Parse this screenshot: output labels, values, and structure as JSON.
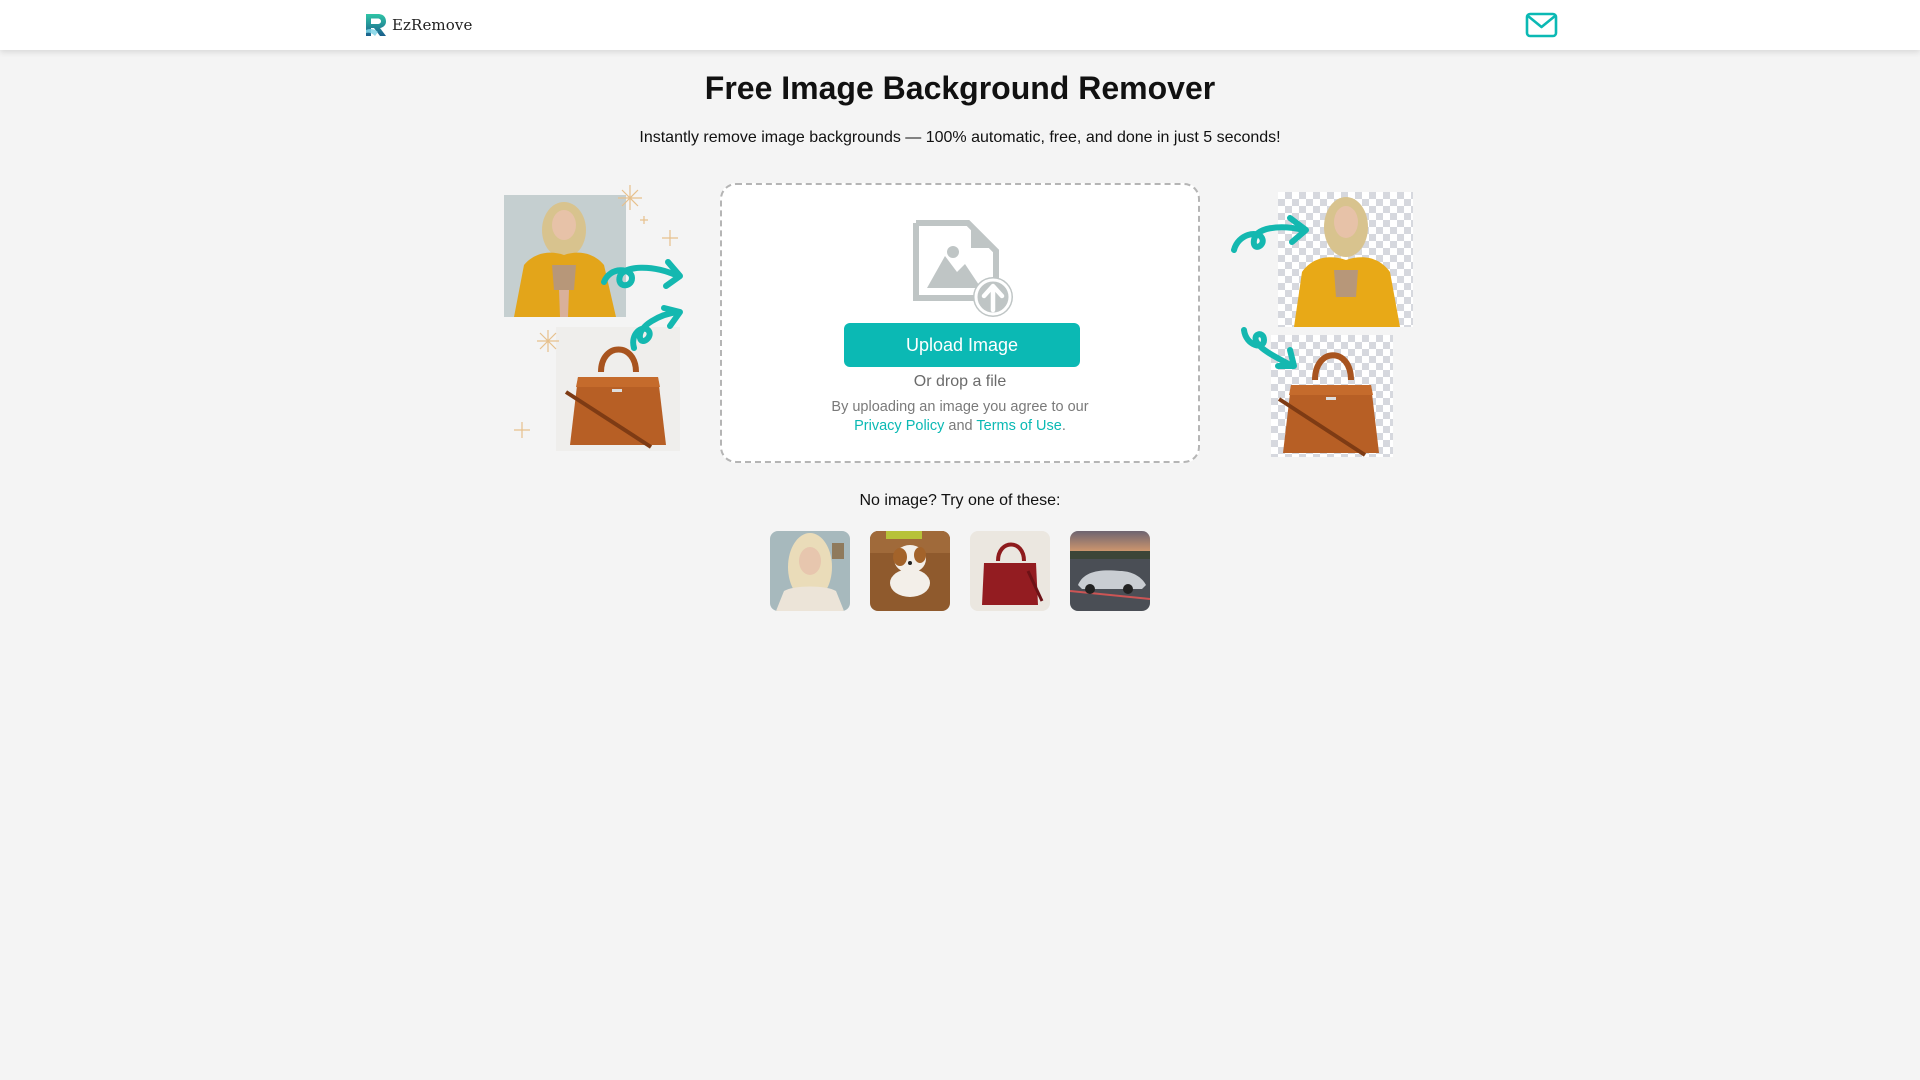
{
  "header": {
    "brand": "EzRemove",
    "logo_icon": "ezremove-logo-icon",
    "contact_icon": "mail-icon"
  },
  "hero": {
    "title": "Free Image Background Remover",
    "subtitle": "Instantly remove image backgrounds — 100% automatic, free, and done in just 5 seconds!"
  },
  "illustrations": {
    "before": [
      {
        "subject": "Woman in yellow jacket",
        "background": "studio gray"
      },
      {
        "subject": "Brown leather handbag",
        "background": "studio white"
      }
    ],
    "after": [
      {
        "subject": "Woman in yellow jacket",
        "background": "transparent"
      },
      {
        "subject": "Brown leather handbag",
        "background": "transparent"
      }
    ]
  },
  "upload": {
    "icon": "image-upload-icon",
    "button_label": "Upload Image",
    "drop_text": "Or drop a file",
    "agree_prefix": "By uploading an image you agree to our",
    "privacy_link": "Privacy Policy",
    "agree_mid": "and",
    "terms_link": "Terms of Use",
    "agree_suffix": "."
  },
  "samples": {
    "label": "No image? Try one of these:",
    "items": [
      {
        "name": "woman",
        "alt": "Blonde woman portrait"
      },
      {
        "name": "puppy",
        "alt": "Puppy on wooden floor"
      },
      {
        "name": "handbag",
        "alt": "Red leather handbag"
      },
      {
        "name": "car",
        "alt": "Silver sports car on track"
      }
    ]
  },
  "colors": {
    "accent": "#0bb9b4",
    "page_bg": "#f4f4f4",
    "dropzone_border": "#b5b5b5",
    "muted_text": "#6b6b6b"
  }
}
